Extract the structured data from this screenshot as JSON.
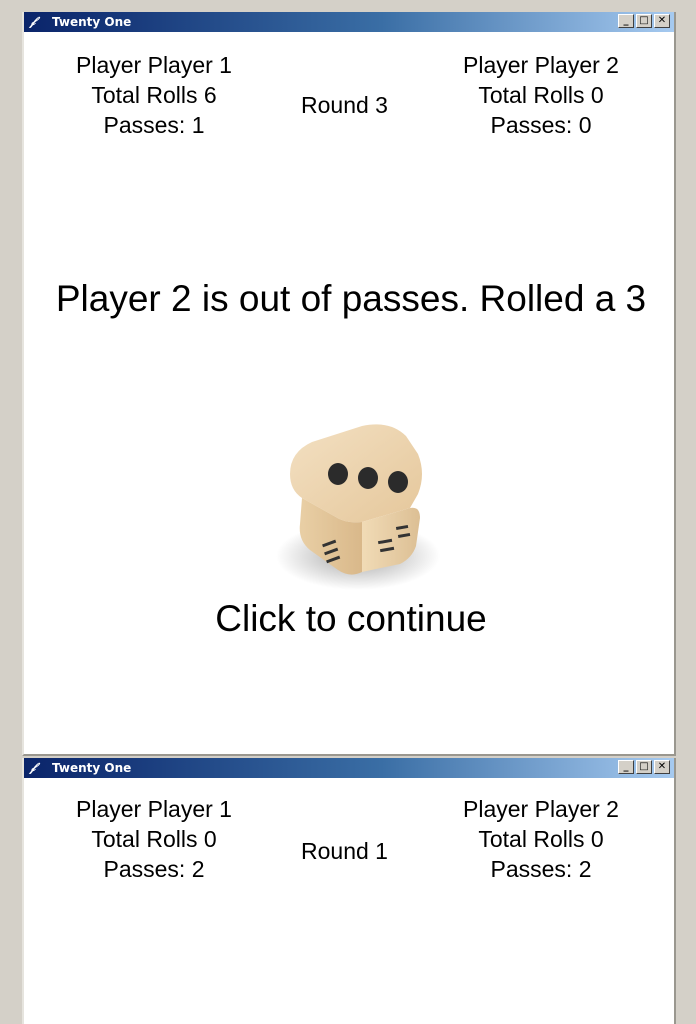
{
  "windows": [
    {
      "title": "Twenty One",
      "player1": {
        "name": "Player Player 1",
        "rolls": "Total Rolls 6",
        "passes": "Passes: 1"
      },
      "player2": {
        "name": "Player Player 2",
        "rolls": "Total Rolls 0",
        "passes": "Passes: 0"
      },
      "round": "Round 3",
      "message": "Player 2 is out of passes.  Rolled a 3",
      "die": {
        "pips": 3,
        "color": "#ecd3ae"
      },
      "continue": "Click to continue"
    },
    {
      "title": "Twenty One",
      "player1": {
        "name": "Player Player 1",
        "rolls": "Total Rolls 0",
        "passes": "Passes: 2"
      },
      "player2": {
        "name": "Player Player 2",
        "rolls": "Total Rolls 0",
        "passes": "Passes: 2"
      },
      "round": "Round 1"
    }
  ],
  "window_controls": {
    "minimize": "_",
    "maximize": "□",
    "close": "✕"
  },
  "icons": {
    "app": "feather-icon"
  },
  "colors": {
    "titlebar_start": "#0a246a",
    "titlebar_end": "#a6caf0"
  }
}
